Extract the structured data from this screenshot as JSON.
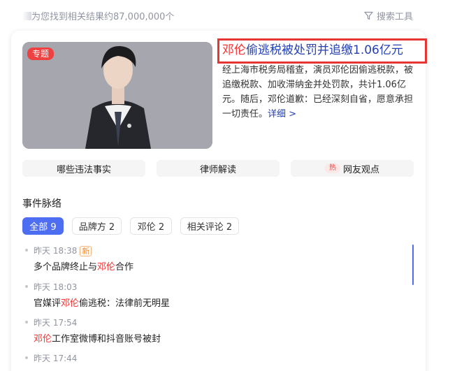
{
  "header": {
    "result_count": "为您找到相关结果约87,000,000个",
    "search_tools": "搜索工具"
  },
  "card": {
    "badge": "专题",
    "title_em": "邓伦",
    "title_rest": "偷逃税被处罚并追缴1.06亿元",
    "summary": "经上海市税务局稽查，演员邓伦因偷逃税款，被追缴税款、加收滞纳金并处罚款，共计1.06亿元。随后，邓伦道歉：已经深刻自省，愿意承担一切责任。",
    "detail_link": "详细 >",
    "tags": [
      {
        "label": "哪些违法事实"
      },
      {
        "label": "律师解读"
      },
      {
        "label": "网友观点",
        "badge": "热"
      }
    ],
    "section_title": "事件脉络",
    "filters": [
      "全部 9",
      "品牌方 2",
      "邓伦 2",
      "相关评论 2"
    ],
    "timeline": [
      {
        "time": "昨天 18:38",
        "badge": "新",
        "pre": "多个品牌终止与",
        "em": "邓伦",
        "post": "合作"
      },
      {
        "time": "昨天 18:03",
        "pre": "官媒评",
        "em": "邓伦",
        "post": "偷逃税：法律前无明星"
      },
      {
        "time": "昨天 17:54",
        "pre": "",
        "em": "邓伦",
        "post": "工作室微博和抖音账号被封"
      },
      {
        "time": "昨天 17:44"
      }
    ]
  },
  "colors": {
    "accent": "#4e6ef2",
    "link": "#2440b3",
    "highlight": "#f73131",
    "annotation_box": "#e53535"
  }
}
